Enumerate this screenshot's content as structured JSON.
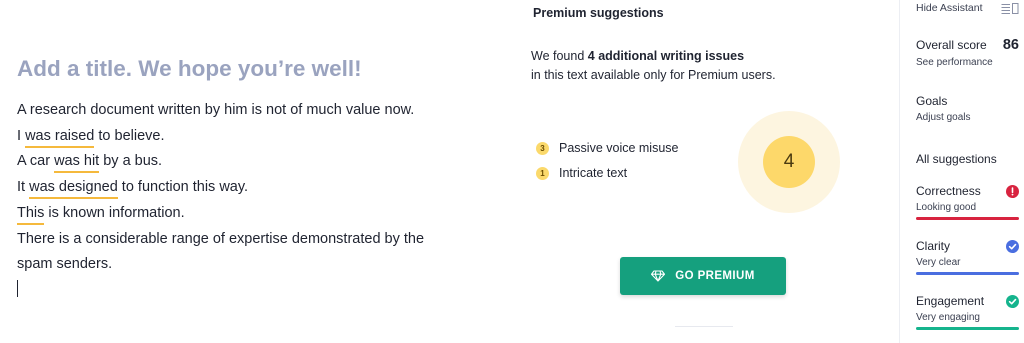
{
  "editor": {
    "title": "Add a title. We hope you’re well!",
    "lines": [
      {
        "pre": "A research document written by him is not of much value now.",
        "hl": "",
        "post": ""
      },
      {
        "pre": "I ",
        "hl": "was raised",
        "post": " to believe."
      },
      {
        "pre": "A car ",
        "hl": "was hit",
        "post": " by a bus."
      },
      {
        "pre": "It ",
        "hl": "was designed",
        "post": " to function this way."
      },
      {
        "pre": "",
        "hl": "This",
        "post": " is known information."
      },
      {
        "pre": "There is a considerable range of expertise demonstrated by the",
        "hl": "",
        "post": ""
      },
      {
        "pre": "spam senders.",
        "hl": "",
        "post": ""
      }
    ]
  },
  "premium": {
    "heading": "Premium suggestions",
    "found_prefix": "We found ",
    "found_bold": "4 additional writing issues",
    "found_line2": "in this text available only for Premium users.",
    "issues": [
      {
        "count": "3",
        "label": "Passive voice misuse"
      },
      {
        "count": "1",
        "label": "Intricate text"
      }
    ],
    "score": "4",
    "button_label": "GO PREMIUM"
  },
  "sidebar": {
    "hide_label": "Hide Assistant",
    "overall_label": "Overall score",
    "overall_value": "86",
    "see_performance": "See performance",
    "goals_label": "Goals",
    "goals_sub": "Adjust goals",
    "all_suggestions": "All suggestions",
    "categories": [
      {
        "name": "Correctness",
        "status": "Looking good",
        "color": "#d8233f",
        "icon": "exclamation-icon"
      },
      {
        "name": "Clarity",
        "status": "Very clear",
        "color": "#4a6ee0",
        "icon": "check-icon"
      },
      {
        "name": "Engagement",
        "status": "Very engaging",
        "color": "#15b48d",
        "icon": "check-icon"
      }
    ]
  }
}
